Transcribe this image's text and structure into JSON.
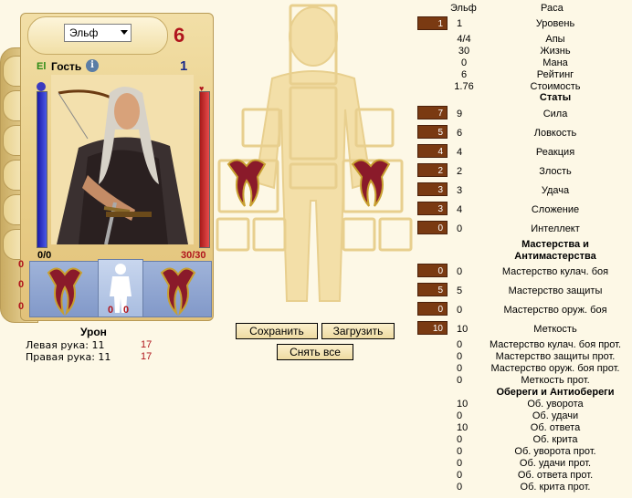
{
  "card": {
    "race": "Эльф",
    "level": "6",
    "clan_tag": "El",
    "name": "Гость",
    "info": "i",
    "small_level": "1",
    "hp_text": "0/0",
    "mp_text": "30/30",
    "hp_fraction": 1.0,
    "mp_fraction": 1.0,
    "rail_numbers": [
      "0",
      "0",
      "0"
    ],
    "body_slot_numbers": [
      "0",
      "0"
    ]
  },
  "damage": {
    "title": "Урон",
    "left_hand_label": "Левая рука: 11",
    "left_hand_value": "17",
    "right_hand_label": "Правая рука: 11",
    "right_hand_value": "17"
  },
  "buttons": {
    "save": "Сохранить",
    "load": "Загрузить",
    "reset": "Снять все"
  },
  "stats": {
    "header_col1": "Эльф",
    "header_col2": "Раса",
    "level": {
      "box": "1",
      "value": "1",
      "name": "Уровень"
    },
    "info_rows": [
      {
        "value": "4/4",
        "name": "Апы"
      },
      {
        "value": "30",
        "name": "Жизнь"
      },
      {
        "value": "0",
        "name": "Мана"
      },
      {
        "value": "6",
        "name": "Рейтинг"
      },
      {
        "value": "1.76",
        "name": "Стоимость"
      }
    ],
    "section_stats": "Статы",
    "stat_rows": [
      {
        "box": "7",
        "value": "9",
        "name": "Сила"
      },
      {
        "box": "5",
        "value": "6",
        "name": "Ловкость"
      },
      {
        "box": "4",
        "value": "4",
        "name": "Реакция"
      },
      {
        "box": "2",
        "value": "2",
        "name": "Злость"
      },
      {
        "box": "3",
        "value": "3",
        "name": "Удача"
      },
      {
        "box": "3",
        "value": "4",
        "name": "Сложение"
      },
      {
        "box": "0",
        "value": "0",
        "name": "Интеллект"
      }
    ],
    "section_mastery_1": "Мастерства и",
    "section_mastery_2": "Антимастерства",
    "mastery_rows": [
      {
        "box": "0",
        "value": "0",
        "name": "Мастерство кулач. боя"
      },
      {
        "box": "5",
        "value": "5",
        "name": "Мастерство защиты"
      },
      {
        "box": "0",
        "value": "0",
        "name": "Мастерство оруж. боя"
      },
      {
        "box": "10",
        "value": "10",
        "name": "Меткость"
      }
    ],
    "anti_rows": [
      {
        "value": "0",
        "name": "Мастерство кулач. боя прот."
      },
      {
        "value": "0",
        "name": "Мастерство защиты прот."
      },
      {
        "value": "0",
        "name": "Мастерство оруж. боя прот."
      },
      {
        "value": "0",
        "name": "Меткость прот."
      }
    ],
    "section_charms": "Обереги и Антиобереги",
    "charm_rows": [
      {
        "value": "10",
        "name": "Об. уворота"
      },
      {
        "value": "0",
        "name": "Об. удачи"
      },
      {
        "value": "10",
        "name": "Об. ответа"
      },
      {
        "value": "0",
        "name": "Об. крита"
      },
      {
        "value": "0",
        "name": "Об. уворота прот."
      },
      {
        "value": "0",
        "name": "Об. удачи прот."
      },
      {
        "value": "0",
        "name": "Об. ответа прот."
      },
      {
        "value": "0",
        "name": "Об. крита прот."
      }
    ]
  }
}
